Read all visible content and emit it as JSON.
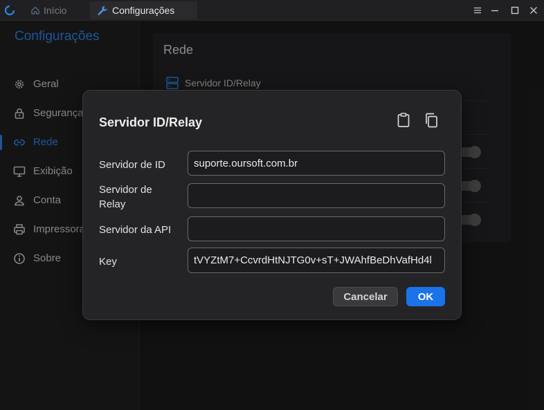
{
  "titlebar": {
    "tabs": [
      {
        "label": "Início"
      },
      {
        "label": "Configurações"
      }
    ]
  },
  "sidebar": {
    "title": "Configurações",
    "items": [
      {
        "label": "Geral",
        "icon": "gear-icon"
      },
      {
        "label": "Segurança",
        "icon": "lock-icon"
      },
      {
        "label": "Rede",
        "icon": "link-icon"
      },
      {
        "label": "Exibição",
        "icon": "monitor-icon"
      },
      {
        "label": "Conta",
        "icon": "user-icon"
      },
      {
        "label": "Impressora",
        "icon": "printer-icon"
      },
      {
        "label": "Sobre",
        "icon": "info-icon"
      }
    ],
    "active_index": 2
  },
  "main": {
    "card_title": "Rede",
    "row_label": "Servidor ID/Relay"
  },
  "dialog": {
    "title": "Servidor ID/Relay",
    "fields": [
      {
        "label": "Servidor de ID",
        "value": "suporte.oursoft.com.br"
      },
      {
        "label": "Servidor de Relay",
        "value": ""
      },
      {
        "label": "Servidor da API",
        "value": ""
      },
      {
        "label": "Key",
        "value": "tVYZtM7+CcvrdHtNJTG0v+sT+JWAhfBeDhVafHd4l"
      }
    ],
    "cancel_label": "Cancelar",
    "ok_label": "OK"
  },
  "colors": {
    "accent": "#2e84e8",
    "ok_button": "#1a73e8",
    "dialog_bg": "#242426"
  }
}
